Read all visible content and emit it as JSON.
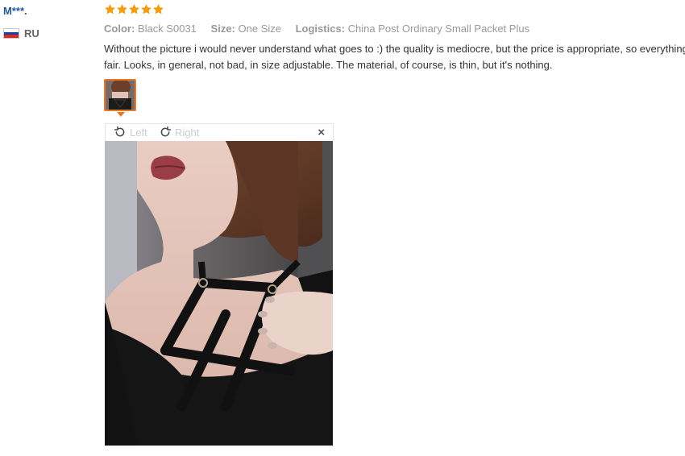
{
  "user": {
    "name": "M***.",
    "country": "RU",
    "flag_colors": [
      "#ffffff",
      "#1c3f9e",
      "#d52b1e"
    ]
  },
  "rating": {
    "stars": 5,
    "max": 5,
    "color": "#f39c12"
  },
  "meta": {
    "color_label": "Color:",
    "color_value": "Black S0031",
    "size_label": "Size:",
    "size_value": "One Size",
    "logistics_label": "Logistics:",
    "logistics_value": "China Post Ordinary Small Packet Plus"
  },
  "review_text": "Without the picture i would never understand what goes to :) the quality is mediocre, but the price is appropriate, so everything is fair. Looks, in general, not bad, in size adjustable. The material, of course, is thin, but it's nothing.",
  "viewer": {
    "rotate_left_label": "Left",
    "rotate_right_label": "Right",
    "close_label": "×",
    "thumbnail_icon": "review-photo-thumbnail",
    "accent_color": "#e8782a"
  }
}
